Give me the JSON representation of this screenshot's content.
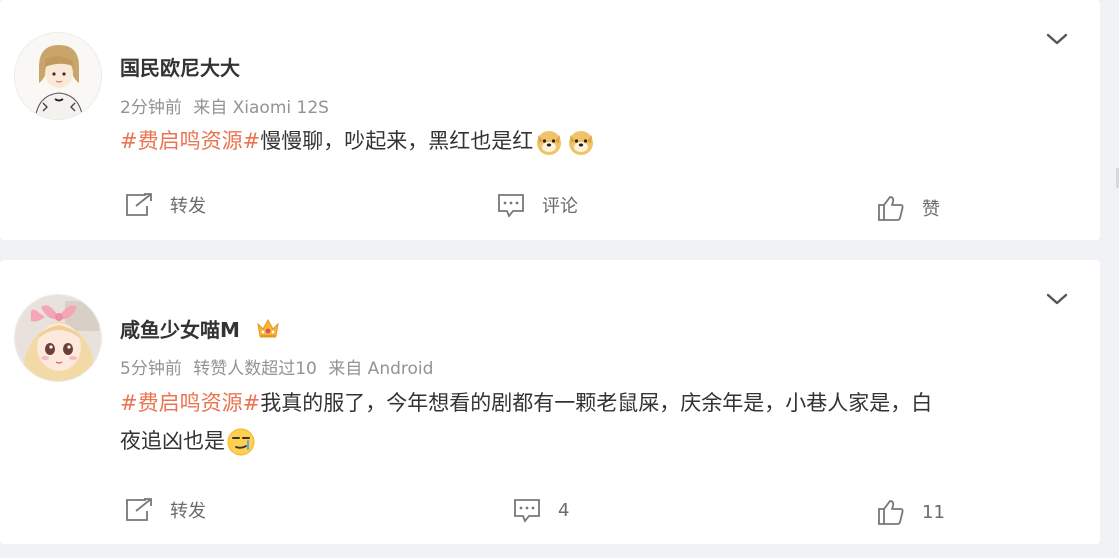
{
  "comments": [
    {
      "username": "国民欧尼大大",
      "time": "2分钟前",
      "forward_note": "",
      "source": "来自 Xiaomi 12S",
      "topic": "#费启鸣资源#",
      "text": "慢慢聊，吵起来，黑红也是红",
      "emojis": [
        "doge-emoji",
        "doge-emoji"
      ],
      "actions": {
        "repost": "转发",
        "comment": "评论",
        "like": "赞"
      }
    },
    {
      "username": "咸鱼少女喵M",
      "badge": "crown-badge-icon",
      "time": "5分钟前",
      "forward_note": "转赞人数超过10",
      "source": "来自 Android",
      "topic": "#费启鸣资源#",
      "text_line1": "我真的服了，今年想看的剧都有一颗老鼠屎，庆余年是，小巷人家是，白",
      "text_line2": "夜追凶也是",
      "emojis": [
        "smirk-emoji"
      ],
      "actions": {
        "repost": "转发",
        "comment": "4",
        "like": "11"
      }
    }
  ],
  "colors": {
    "topic": "#eb7350",
    "text": "#333333",
    "meta": "#939393",
    "background": "#f1f2f5"
  }
}
